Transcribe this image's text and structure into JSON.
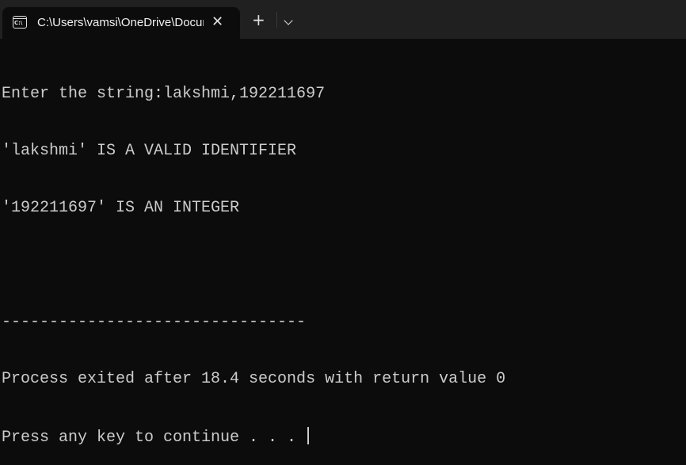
{
  "tab": {
    "title": "C:\\Users\\vamsi\\OneDrive\\Documents",
    "icon": "console-icon",
    "icon_text": "C:\\"
  },
  "console": {
    "lines": [
      "Enter the string:lakshmi,192211697",
      "'lakshmi' IS A VALID IDENTIFIER",
      "'192211697' IS AN INTEGER",
      "",
      "--------------------------------",
      "Process exited after 18.4 seconds with return value 0",
      "Press any key to continue . . . "
    ]
  },
  "colors": {
    "background": "#0c0c0c",
    "text": "#cccccc",
    "tabbar": "#202020"
  }
}
